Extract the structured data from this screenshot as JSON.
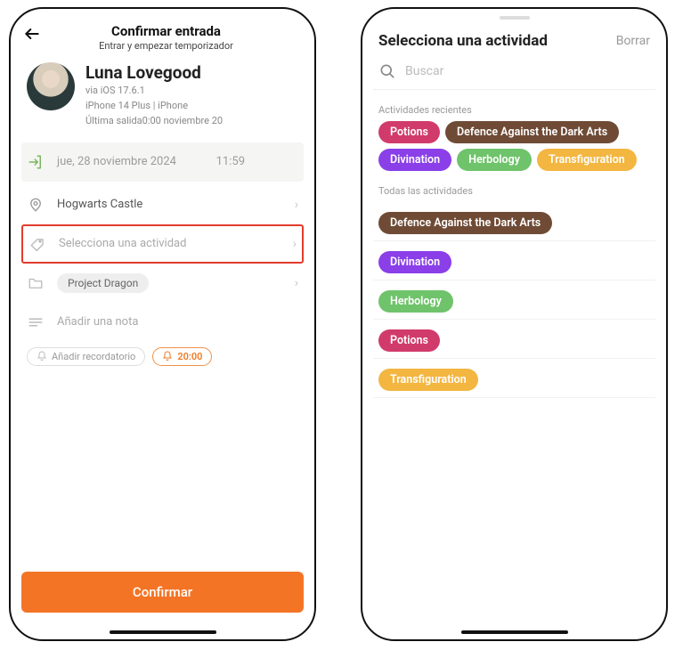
{
  "left": {
    "header": {
      "title": "Confirmar entrada",
      "subtitle": "Entrar y empezar temporizador"
    },
    "user": {
      "name": "Luna Lovegood",
      "meta1": "via iOS 17.6.1",
      "meta2": "iPhone 14 Plus | iPhone",
      "meta3": "Última salida0:00 noviembre 20"
    },
    "date": {
      "text": "jue, 28 noviembre 2024",
      "time": "11:59"
    },
    "location": "Hogwarts Castle",
    "activity_placeholder": "Selecciona una actividad",
    "project": "Project Dragon",
    "note_placeholder": "Añadir una nota",
    "add_reminder": "Añadir recordatorio",
    "reminder_time": "20:00",
    "confirm": "Confirmar"
  },
  "right": {
    "title": "Selecciona una actividad",
    "clear": "Borrar",
    "search_placeholder": "Buscar",
    "recent_label": "Actividades recientes",
    "all_label": "Todas las actividades",
    "recent": [
      {
        "label": "Potions",
        "color": "#d13b6b"
      },
      {
        "label": "Defence Against the Dark Arts",
        "color": "#6f4b36"
      },
      {
        "label": "Divination",
        "color": "#8a3fe8"
      },
      {
        "label": "Herbology",
        "color": "#6fc36b"
      },
      {
        "label": "Transfiguration",
        "color": "#f3b640"
      }
    ],
    "all": [
      {
        "label": "Defence Against the Dark Arts",
        "color": "#6f4b36"
      },
      {
        "label": "Divination",
        "color": "#8a3fe8"
      },
      {
        "label": "Herbology",
        "color": "#6fc36b"
      },
      {
        "label": "Potions",
        "color": "#d13b6b"
      },
      {
        "label": "Transfiguration",
        "color": "#f3b640"
      }
    ]
  }
}
